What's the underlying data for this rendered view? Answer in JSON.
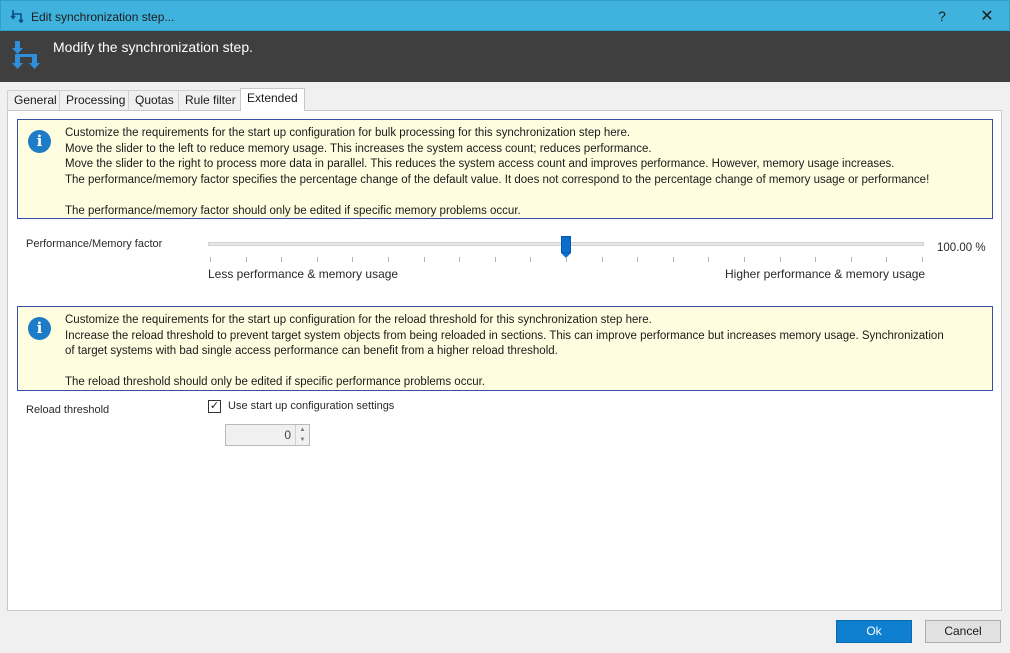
{
  "window": {
    "title": "Edit synchronization step...",
    "help_label": "?",
    "close_label": "✕"
  },
  "header": {
    "text": "Modify the synchronization step."
  },
  "tabs": [
    {
      "label": "General"
    },
    {
      "label": "Processing"
    },
    {
      "label": "Quotas"
    },
    {
      "label": "Rule filter"
    },
    {
      "label": "Extended",
      "active": true
    }
  ],
  "info1": {
    "icon": "info-icon",
    "lines": [
      "Customize the requirements for the start up configuration for bulk processing for this synchronization step here.",
      "Move the slider to the left to reduce memory usage. This increases the system access count; reduces performance.",
      "Move the slider to the right to process more data in parallel. This reduces the system access count and improves performance. However, memory usage increases.",
      "The performance/memory factor specifies the percentage change of the default value. It does not correspond to the percentage change of memory usage or performance!",
      "The performance/memory factor should only be edited if specific memory problems occur."
    ]
  },
  "factor": {
    "label": "Performance/Memory factor",
    "value_text": "100.00 %",
    "slider_fraction": 0.5,
    "left_caption": "Less performance & memory usage",
    "right_caption": "Higher performance & memory usage"
  },
  "info2": {
    "icon": "info-icon",
    "lines": [
      "Customize the requirements for the start up configuration for the reload threshold for this synchronization step here.",
      "Increase the reload threshold to prevent target system objects from being reloaded in sections. This can improve performance but increases memory usage. Synchronization",
      "of target systems with bad single access performance can benefit from a higher reload threshold.",
      "The reload threshold should only be edited if specific performance problems occur."
    ]
  },
  "reload": {
    "label": "Reload threshold",
    "checkbox_label": "Use start up configuration settings",
    "checked": true,
    "value": "0"
  },
  "buttons": {
    "ok": "Ok",
    "cancel": "Cancel"
  },
  "colors": {
    "titlebar": "#3fb3dd",
    "header": "#3f3f3f",
    "accent": "#0f7fd0",
    "info_bg": "#fffde0",
    "info_border": "#3a50a6"
  }
}
